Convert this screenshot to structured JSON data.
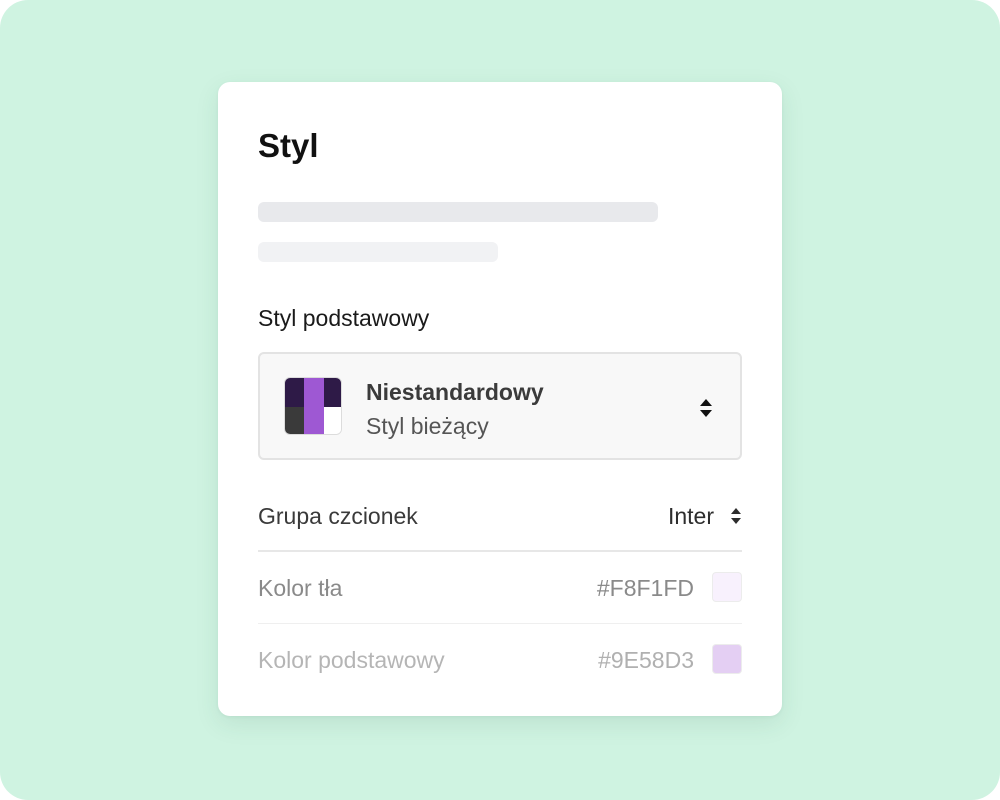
{
  "panel": {
    "title": "Styl",
    "section_label": "Styl podstawowy"
  },
  "theme_select": {
    "name": "Niestandardowy",
    "subtitle": "Styl bieżący",
    "preview_colors": [
      "#2e1a47",
      "#3a3a3a",
      "#9e58d3",
      "#ffffff"
    ],
    "icon": "chevron-up-down-icon"
  },
  "font_group": {
    "label": "Grupa czcionek",
    "value": "Inter",
    "icon": "chevron-up-down-icon"
  },
  "background_color": {
    "label": "Kolor tła",
    "hex": "#F8F1FD",
    "swatch": "#F8F1FD"
  },
  "primary_color": {
    "label": "Kolor podstawowy",
    "hex": "#9E58D3",
    "swatch": "#E4CFF3"
  },
  "colors": {
    "canvas_background": "#cff3e1",
    "card_background": "#ffffff"
  }
}
